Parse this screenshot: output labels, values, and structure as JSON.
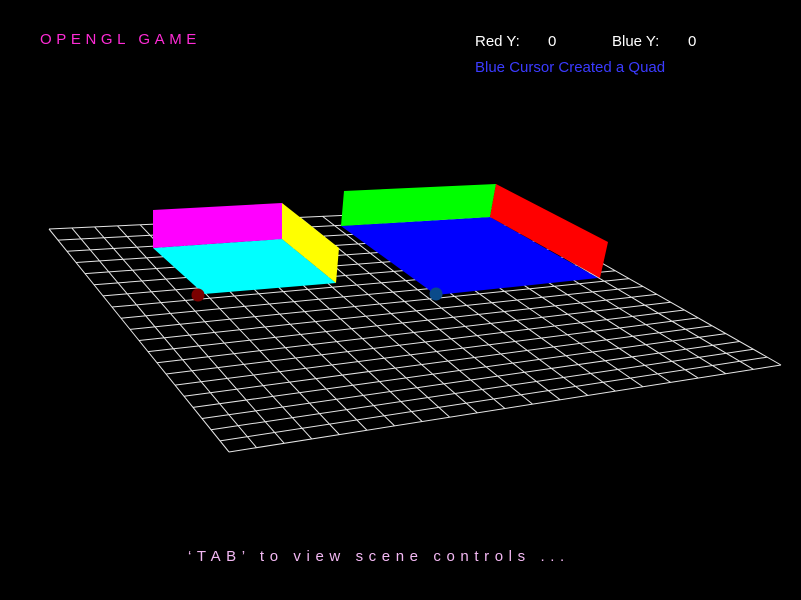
{
  "hud": {
    "title": "OPENGL GAME",
    "red_y_label": "Red Y:",
    "red_y_value": "0",
    "blue_y_label": "Blue Y:",
    "blue_y_value": "0",
    "status_message": "Blue Cursor Created a Quad",
    "hint": "‘TAB’ to view scene controls ..."
  },
  "scene": {
    "grid": {
      "divisions": 20,
      "color": "#e6e6e6"
    },
    "quads": [
      {
        "name": "quad-left",
        "faces": [
          {
            "name": "floor",
            "color": "#00ffff"
          },
          {
            "name": "back-wall",
            "color": "#ff00ff"
          },
          {
            "name": "side-wall",
            "color": "#ffff00"
          }
        ]
      },
      {
        "name": "quad-right",
        "faces": [
          {
            "name": "floor",
            "color": "#0000ff"
          },
          {
            "name": "back-wall",
            "color": "#00ff00"
          },
          {
            "name": "side-wall",
            "color": "#ff0000"
          }
        ]
      }
    ],
    "cursors": [
      {
        "name": "red-cursor",
        "color": "#7a0000"
      },
      {
        "name": "blue-cursor",
        "color": "#0a4a8a"
      }
    ]
  }
}
